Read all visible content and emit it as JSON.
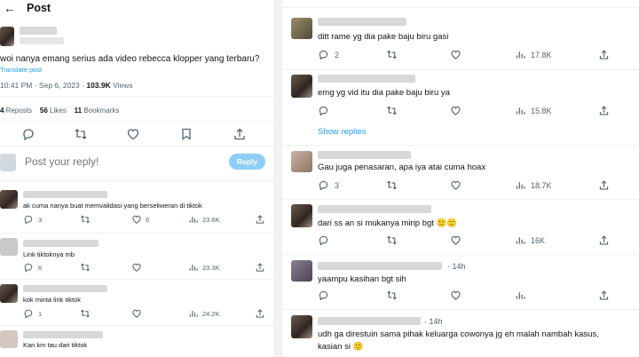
{
  "header": {
    "back_icon": "back-arrow-icon",
    "title": "Post"
  },
  "post": {
    "text": "woi nanya emang serius ada video rebecca klopper yang terbaru?",
    "translate": "Translate post",
    "time": "10:41 PM · Sep 6, 2023 · ",
    "views_count": "103.9K",
    "views_label": " Views",
    "reposts_count": "4",
    "reposts_label": " Reposts",
    "likes_count": "56",
    "likes_label": " Likes",
    "bookmarks_count": "11",
    "bookmarks_label": " Bookmarks"
  },
  "composer": {
    "placeholder": "Post your reply!",
    "button": "Reply"
  },
  "left_replies": [
    {
      "text": "ak cuma nanya buat memvalidasi yang berseliweran di tiktok",
      "replies": "3",
      "likes": "6",
      "views": "23.6K"
    },
    {
      "text": "Link tiktoknya mb",
      "replies": "6",
      "likes": "",
      "views": "23.3K"
    },
    {
      "text": "kok minta link tiktok",
      "replies": "1",
      "likes": "",
      "views": "24.2K"
    },
    {
      "text": "Kan km tau dari tiktok"
    }
  ],
  "right_replies": [
    {
      "text": "ditt rame yg dia pake baju biru gasi",
      "replies": "2",
      "views": "17.8K"
    },
    {
      "text": "emg yg vid itu dia pake baju biru ya",
      "views": "15.8K",
      "show_replies": "Show replies"
    },
    {
      "text": "Gau juga penasaran, apa iya atai cuma hoax",
      "replies": "3",
      "views": "18.7K"
    },
    {
      "text": "dari ss an si mukanya mirip bgt 🙂🙂",
      "handle": "... @...",
      "views": "16K"
    },
    {
      "text": "yaampu kasihan bgt sih",
      "time": "· 14h"
    },
    {
      "text_line1": "udh ga direstuin sama pihak keluarga cowonya jg eh malah nambah kasus,",
      "text_line2": "kasian si 🙂",
      "time": "· 14h"
    }
  ],
  "colors": {
    "accent": "#1d9bf0",
    "reply_button": "#8ecdf8",
    "muted": "#536471"
  }
}
